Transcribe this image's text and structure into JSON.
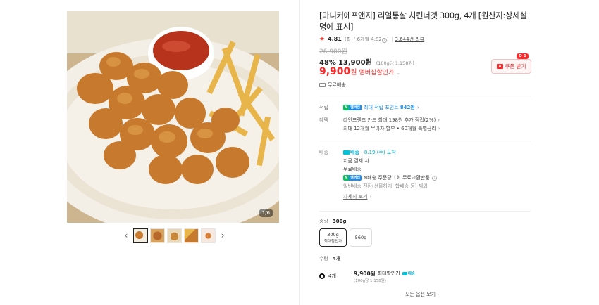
{
  "gallery": {
    "counter": "1/6",
    "prev_label": "‹",
    "next_label": "›",
    "thumbnail_count": 5
  },
  "product": {
    "title": "[마니커에프앤지] 리얼통살 치킨너겟 300g, 4개 [원산지:상세설명에 표시]",
    "rating": "4.81",
    "rating_detail": "(최근 6개월 4.82",
    "rating_detail_close": ")",
    "review_count": "3,644건 리뷰",
    "original_price": "26,900원",
    "discount_rate": "48%",
    "discount_price": "13,900원",
    "unit_price": "(100g당 1,158원)",
    "member_price": "9,900",
    "member_price_unit": "원",
    "member_label": "멤버십할인가",
    "shipping_fee": "무료배송"
  },
  "coupon": {
    "badge": "D-1",
    "label": "쿠폰 받기"
  },
  "benefits": {
    "point_label": "적립",
    "npay_n": "N",
    "npay_m": "멤버십",
    "point_text": "최대 적립 포인트 ",
    "point_value": "842원",
    "benefit_label": "혜택",
    "benefit_line1": "라인프렌즈 카드 최대 198원 추가 적립(2%)",
    "benefit_line2": "최대 12개월 무이자 할부 • 60개월 특별금리"
  },
  "delivery": {
    "label": "배송",
    "tag": "배송",
    "arrival": "8.19 (수) 도착",
    "line1": "지금 결제 시",
    "line2": "무료배송",
    "line3": "N배송 주문당 1회 무료교환반품",
    "line4": "일반배송 전환(선물하기, 합배송 등) 제외",
    "more": "자세히 보기"
  },
  "options": {
    "weight_label": "중량",
    "weight_value": "300g",
    "buttons": [
      {
        "label": "300g",
        "sub": "최대할인가"
      },
      {
        "label": "560g",
        "sub": ""
      }
    ],
    "qty_label": "수량",
    "qty_value": "4개"
  },
  "selected_option": {
    "name": "4개",
    "price": "9,900원",
    "price_label": "최대할인가",
    "tag": "배송",
    "unit_price": "(100g당 1,158원)"
  },
  "footer": {
    "more_options": "모든 옵션 보기"
  },
  "colors": {
    "accent_red": "#fa2828",
    "npay_green": "#03c75a",
    "membership_blue": "#1e8be8",
    "delivery_teal": "#03a9c7"
  }
}
